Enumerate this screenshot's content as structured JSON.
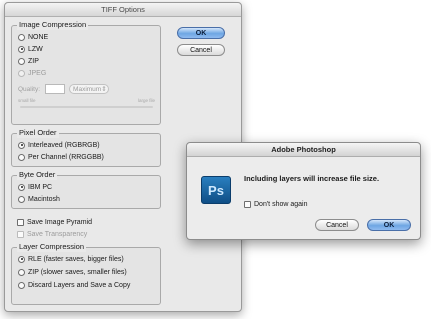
{
  "tiff": {
    "title": "TIFF Options",
    "ok": "OK",
    "cancel": "Cancel",
    "image_compression": {
      "label": "Image Compression",
      "options": [
        "NONE",
        "LZW",
        "ZIP",
        "JPEG"
      ],
      "selected": "LZW",
      "quality_label": "Quality:",
      "quality_value": "",
      "quality_preset": "Maximum",
      "small_file": "small file",
      "large_file": "large file"
    },
    "pixel_order": {
      "label": "Pixel Order",
      "options": [
        "Interleaved (RGBRGB)",
        "Per Channel (RRGGBB)"
      ],
      "selected": "Interleaved (RGBRGB)"
    },
    "byte_order": {
      "label": "Byte Order",
      "options": [
        "IBM PC",
        "Macintosh"
      ],
      "selected": "IBM PC"
    },
    "save_image_pyramid": "Save Image Pyramid",
    "save_transparency": "Save Transparency",
    "layer_compression": {
      "label": "Layer Compression",
      "options": [
        "RLE (faster saves, bigger files)",
        "ZIP (slower saves, smaller files)",
        "Discard Layers and Save a Copy"
      ],
      "selected": "RLE (faster saves, bigger files)"
    }
  },
  "alert": {
    "title": "Adobe Photoshop",
    "icon_text": "Ps",
    "message": "Including layers will increase file size.",
    "dont_show": "Don't show again",
    "cancel": "Cancel",
    "ok": "OK"
  },
  "colors": {
    "default_button": "#6ea6e3",
    "ps_icon": "#1b64a3"
  }
}
